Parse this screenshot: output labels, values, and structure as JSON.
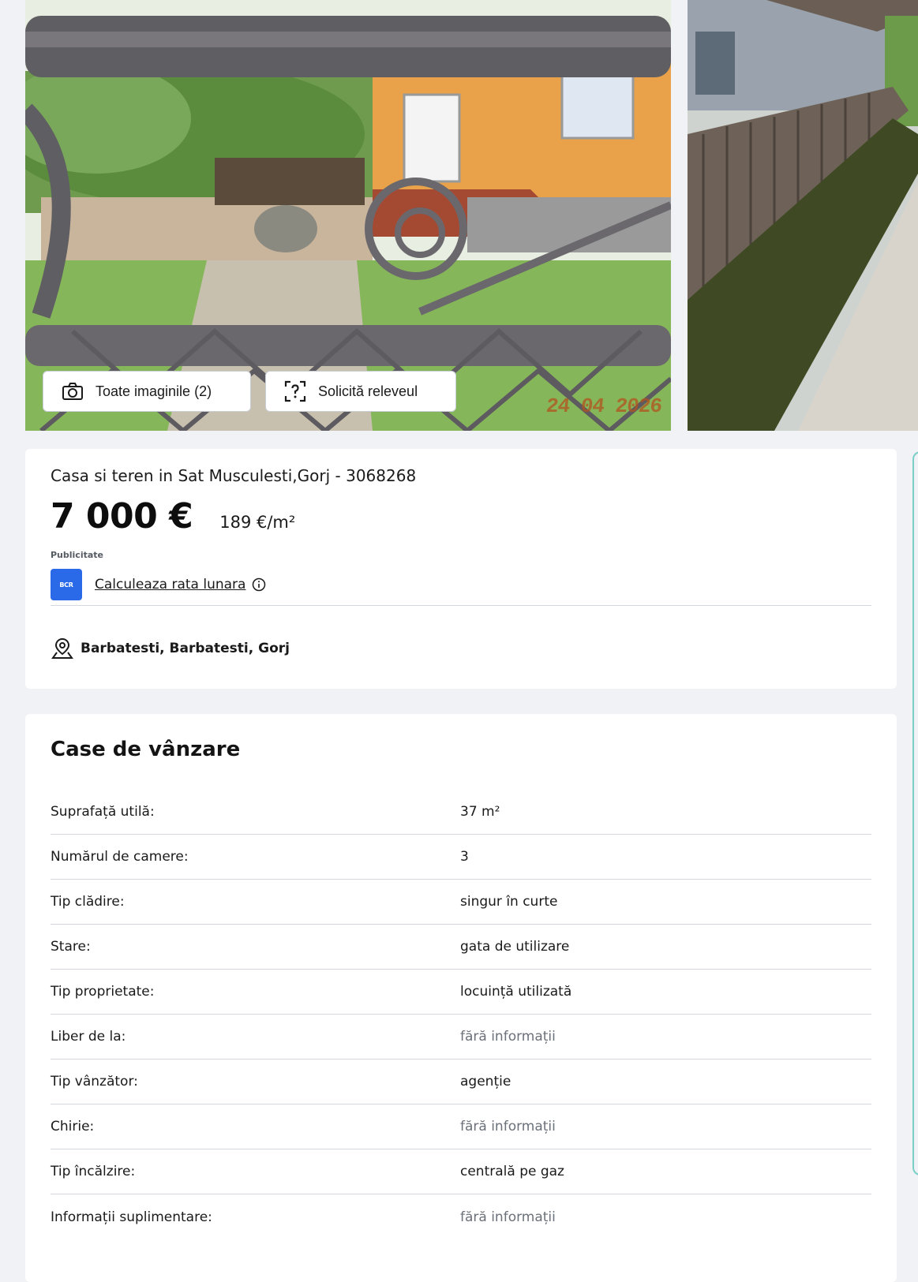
{
  "gallery": {
    "all_images_label": "Toate imaginile (2)",
    "survey_label": "Solicită releveul",
    "photo_date_stamp": "24 04 2026",
    "camera_icon": "camera-icon",
    "survey_icon": "floorplan-question-icon"
  },
  "listing": {
    "title": "Casa si teren in Sat Musculesti,Gorj - 3068268",
    "price": "7 000 €",
    "price_per_sqm": "189 €/m²",
    "promo_label": "Publicitate",
    "bank_logo_text": "BCR",
    "calc_link": "Calculeaza rata lunara",
    "location": "Barbatesti, Barbatesti, Gorj",
    "location_icon": "map-pin-icon"
  },
  "details": {
    "title": "Case de vânzare",
    "rows": [
      {
        "label": "Suprafață utilă:",
        "value": "37 m²",
        "muted": false
      },
      {
        "label": "Numărul de camere:",
        "value": "3",
        "muted": false
      },
      {
        "label": "Tip clădire:",
        "value": "singur în curte",
        "muted": false
      },
      {
        "label": "Stare:",
        "value": "gata de utilizare",
        "muted": false
      },
      {
        "label": "Tip proprietate:",
        "value": "locuință utilizată",
        "muted": false
      },
      {
        "label": "Liber de la:",
        "value": "fără informații",
        "muted": true
      },
      {
        "label": "Tip vânzător:",
        "value": "agenție",
        "muted": false
      },
      {
        "label": "Chirie:",
        "value": "fără informații",
        "muted": true
      },
      {
        "label": "Tip încălzire:",
        "value": "centrală pe gaz",
        "muted": false
      },
      {
        "label": "Informații suplimentare:",
        "value": "fără informații",
        "muted": true
      }
    ]
  },
  "colors": {
    "page_bg": "#f0f2f5",
    "card_bg": "#ffffff",
    "bank_blue": "#2a6ae8",
    "muted_text": "#6b7079",
    "accent_teal": "#7bcfc6"
  }
}
